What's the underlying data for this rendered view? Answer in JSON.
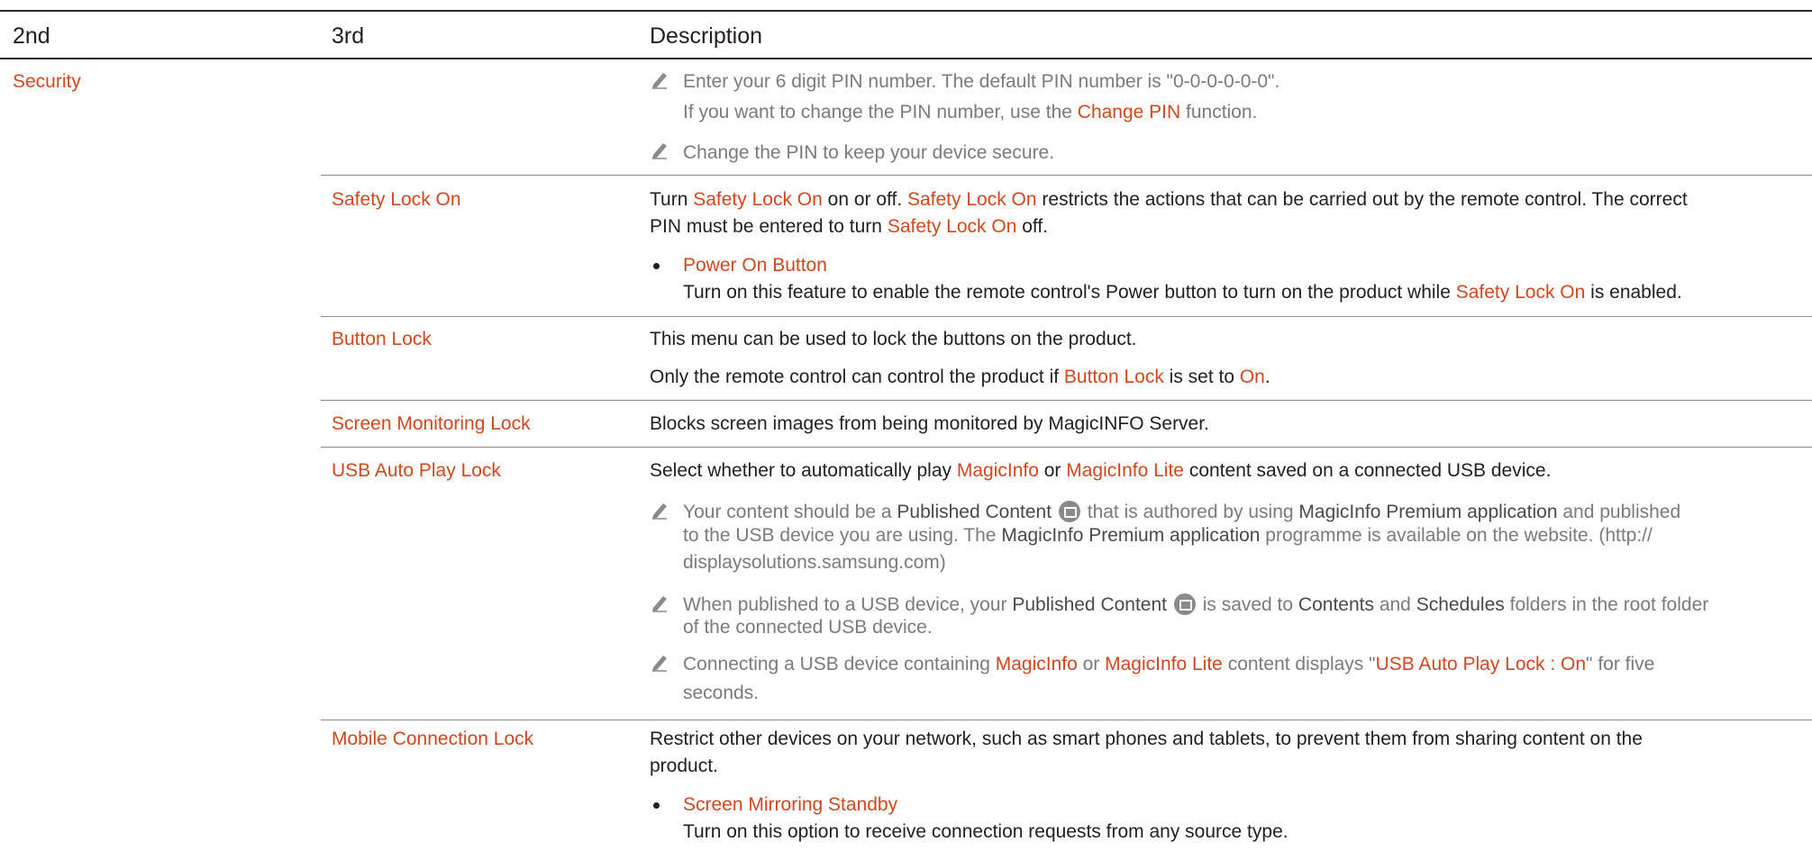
{
  "header": {
    "col1": "2nd",
    "col2": "3rd",
    "col3": "Description"
  },
  "section_label": "Security",
  "pin_notes": {
    "note1_line1": "Enter your 6 digit PIN number. The default PIN number is \"0-0-0-0-0-0\".",
    "note1_line2_a": "If you want to change the PIN number, use the ",
    "note1_line2_link": "Change PIN",
    "note1_line2_b": " function.",
    "note2": "Change the PIN to keep your device secure."
  },
  "safety_lock": {
    "label": "Safety Lock On",
    "d1_a": "Turn ",
    "d1_l1": "Safety Lock On",
    "d1_b": " on or off. ",
    "d1_l2": "Safety Lock On",
    "d1_c": " restricts the actions that can be carried out by the remote control. The correct",
    "d2_a": "PIN must be entered to turn ",
    "d2_l": "Safety Lock On",
    "d2_b": " off.",
    "bullet_title": "Power On Button",
    "bullet_text_a": "Turn on this feature to enable the remote control's Power button to turn on the product while ",
    "bullet_text_l": "Safety Lock On",
    "bullet_text_b": " is enabled."
  },
  "button_lock": {
    "label": "Button Lock",
    "d1": "This menu can be used to lock the buttons on the product.",
    "d2_a": "Only the remote control can control the product if ",
    "d2_l1": "Button Lock",
    "d2_b": " is set to ",
    "d2_l2": "On",
    "d2_c": "."
  },
  "screen_monitoring_lock": {
    "label": "Screen Monitoring Lock",
    "d1": "Blocks screen images from being monitored by MagicINFO Server."
  },
  "usb_auto_play_lock": {
    "label": "USB Auto Play Lock",
    "d1_a": "Select whether to automatically play ",
    "d1_l1": "MagicInfo",
    "d1_b": " or ",
    "d1_l2": "MagicInfo Lite",
    "d1_c": " content saved on a connected USB device.",
    "n1_a": "Your content should be a ",
    "n1_e1": "Published Content",
    "n1_b": " that is authored by using ",
    "n1_e2": "MagicInfo Premium application",
    "n1_c": " and published",
    "n1_l2_a": "to the USB device you are using. The ",
    "n1_l2_e": "MagicInfo Premium application",
    "n1_l2_b": " programme is available on the website. (http://",
    "n1_l3": "displaysolutions.samsung.com)",
    "n2_a": "When published to a USB device, your ",
    "n2_e1": "Published Content",
    "n2_b": " is saved to ",
    "n2_e2": "Contents",
    "n2_c": " and ",
    "n2_e3": "Schedules",
    "n2_d": " folders in the root folder",
    "n2_l2": "of the connected USB device.",
    "n3_a": "Connecting a USB device containing ",
    "n3_l1": "MagicInfo",
    "n3_b": " or ",
    "n3_l2": "MagicInfo Lite",
    "n3_c": " content displays \"",
    "n3_l3": "USB Auto Play Lock : On",
    "n3_d": "\" for five",
    "n3_l4": "seconds."
  },
  "mobile_connection_lock": {
    "label": "Mobile Connection Lock",
    "d1": "Restrict other devices on your network, such as smart phones and tablets, to prevent them from sharing content on the",
    "d2": "product.",
    "bullet_title": "Screen Mirroring Standby",
    "bullet_text": "Turn on this option to receive connection requests from any source type."
  },
  "colors": {
    "accent": "#d0481f",
    "text": "#231f20",
    "note": "#7b7b7b",
    "rule": "#2b2b2b"
  },
  "icons": {
    "note": "pencil-icon",
    "content": "published-content-icon",
    "list": "bullet-icon"
  }
}
